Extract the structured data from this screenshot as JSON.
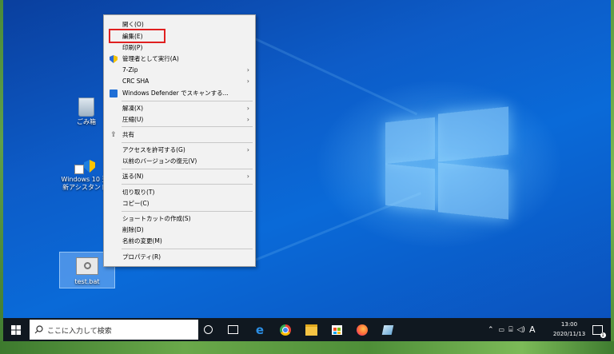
{
  "desktop": {
    "icons": [
      {
        "label": "ごみ箱",
        "icon": "recycle-bin-icon"
      },
      {
        "label": "Windows 10 更新アシスタント",
        "icon": "windows-update-assistant-icon"
      },
      {
        "label": "test.bat",
        "icon": "batch-file-icon",
        "selected": true
      }
    ]
  },
  "context_menu": {
    "items": [
      {
        "label": "開く(O)"
      },
      {
        "label": "編集(E)",
        "highlighted": true
      },
      {
        "label": "印刷(P)"
      },
      {
        "label": "管理者として実行(A)",
        "icon": "shield-icon"
      },
      {
        "label": "7-Zip",
        "submenu": true
      },
      {
        "label": "CRC SHA",
        "submenu": true
      },
      {
        "label": "Windows Defender でスキャンする...",
        "icon": "defender-icon"
      },
      {
        "label": "解凍(X)",
        "submenu": true
      },
      {
        "label": "圧縮(U)",
        "submenu": true
      },
      {
        "label": "共有",
        "icon": "share-icon"
      },
      {
        "label": "アクセスを許可する(G)",
        "submenu": true
      },
      {
        "label": "以前のバージョンの復元(V)"
      },
      {
        "label": "送る(N)",
        "submenu": true
      },
      {
        "label": "切り取り(T)"
      },
      {
        "label": "コピー(C)"
      },
      {
        "label": "ショートカットの作成(S)"
      },
      {
        "label": "削除(D)"
      },
      {
        "label": "名前の変更(M)"
      },
      {
        "label": "プロパティ(R)"
      }
    ],
    "highlight_color": "#e02020"
  },
  "taskbar": {
    "search_placeholder": "ここに入力して検索",
    "apps": [
      "task-view-icon",
      "edge-icon",
      "chrome-icon",
      "file-explorer-icon",
      "store-icon",
      "firefox-icon",
      "app-icon"
    ],
    "ime": "A",
    "time": "13:00",
    "date": "2020/11/13",
    "notification_count": "1"
  }
}
